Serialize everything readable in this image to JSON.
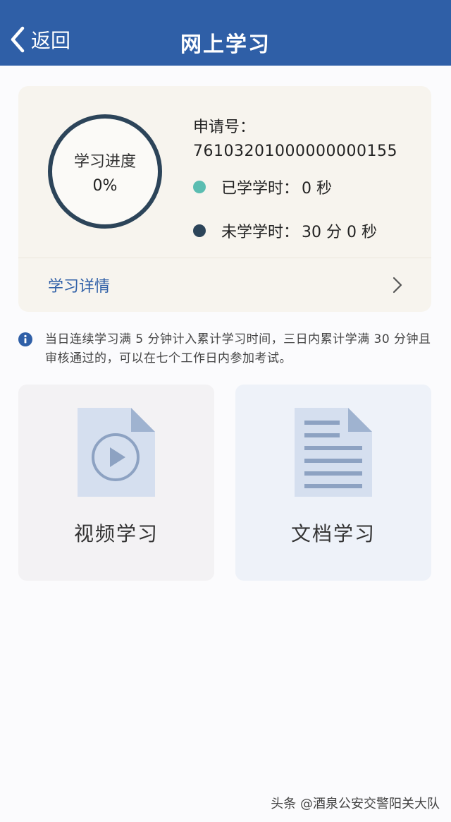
{
  "header": {
    "back_label": "返回",
    "title": "网上学习",
    "background": "#2f5fa7"
  },
  "progress": {
    "label": "学习进度",
    "value": "0%",
    "fraction": 0,
    "application_no_label": "申请号：",
    "application_no": "76103201000000000155",
    "learned_label": "已学学时：",
    "learned_value": "0 秒",
    "learned_color": "#5bbdb1",
    "remaining_label": "未学学时：",
    "remaining_value": "30 分 0 秒",
    "remaining_color": "#2c4459",
    "details_label": "学习详情"
  },
  "notice": {
    "icon": "info-icon",
    "text": "当日连续学习满 5 分钟计入累计学习时间，三日内累计学满 30 分钟且审核通过的，可以在七个工作日内参加考试。"
  },
  "tiles": {
    "video": {
      "label": "视频学习",
      "icon": "video-file-icon"
    },
    "document": {
      "label": "文档学习",
      "icon": "document-file-icon"
    }
  },
  "watermark": "头条 @酒泉公安交警阳关大队"
}
